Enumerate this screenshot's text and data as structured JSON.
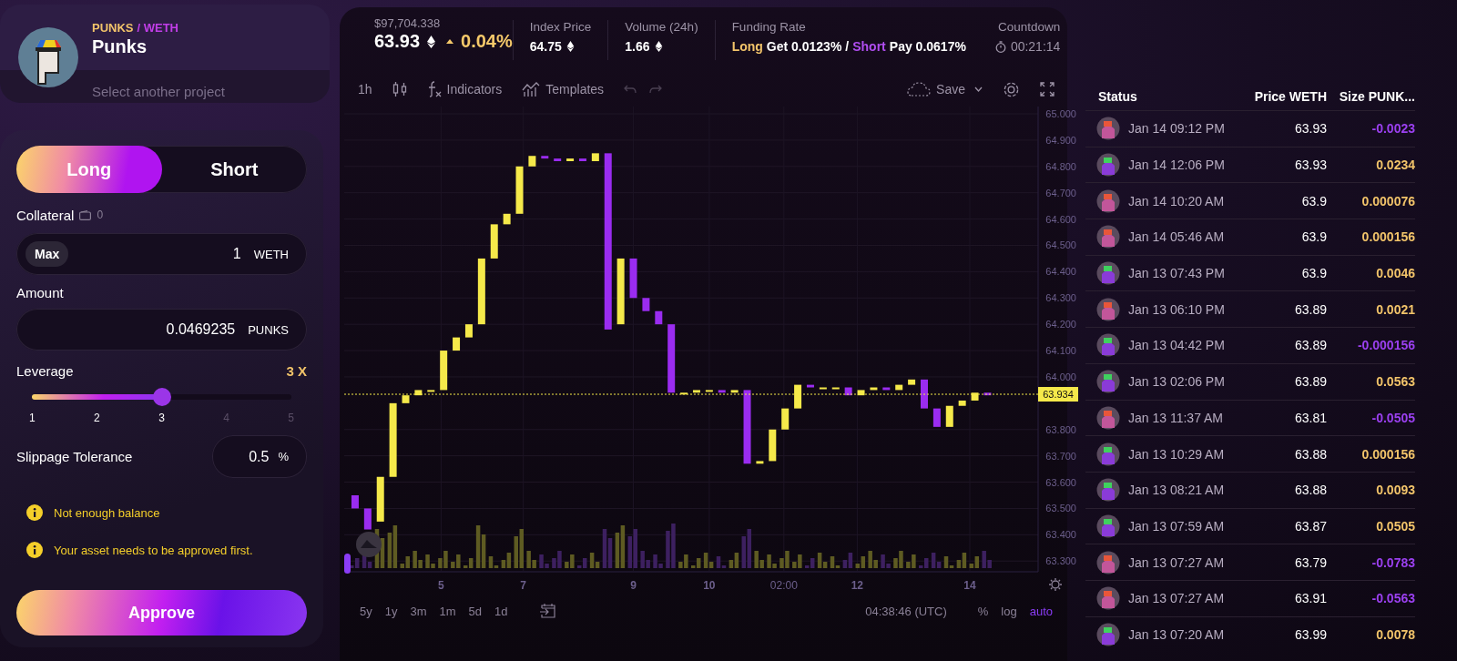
{
  "project": {
    "base": "PUNKS",
    "quote": "/ WETH",
    "name": "Punks",
    "action": "Select another project"
  },
  "order": {
    "sides": [
      {
        "label": "Long",
        "selected": true
      },
      {
        "label": "Short",
        "selected": false
      }
    ],
    "collateral": {
      "label": "Collateral",
      "balance": "0",
      "max": "Max",
      "value": "1",
      "unit": "WETH"
    },
    "amount": {
      "label": "Amount",
      "value": "0.0469235",
      "unit": "PUNKS"
    },
    "leverage": {
      "label": "Leverage",
      "reading": "3 X",
      "level": 0.5,
      "ticks": [
        "1",
        "2",
        "3",
        "4",
        "5"
      ]
    },
    "slippage": {
      "label": "Slippage Tolerance",
      "value": "0.5",
      "unit": "%"
    },
    "warnings": [
      "Not enough balance",
      "Your asset needs to be approved first."
    ],
    "submit": "Approve"
  },
  "market": {
    "usd": "$97,704.338",
    "price": "63.93",
    "change": "0.04%",
    "change_up": true,
    "stats": [
      {
        "label": "Index Price",
        "value": "64.75"
      },
      {
        "label": "Volume (24h)",
        "value": "1.66"
      }
    ],
    "funding": {
      "label": "Funding Rate",
      "long": "Long",
      "long_text": "Get 0.0123%",
      "sep": "/",
      "short": "Short",
      "short_text": "Pay 0.0617%"
    },
    "countdown": {
      "label": "Countdown",
      "value": "00:21:14"
    }
  },
  "toolbar": {
    "interval": "1h",
    "indicators": "Indicators",
    "templates": "Templates",
    "save": "Save"
  },
  "chart": {
    "price_axis": [
      "65.000",
      "64.900",
      "64.800",
      "64.700",
      "64.600",
      "64.500",
      "64.400",
      "64.300",
      "64.200",
      "64.100",
      "64.000",
      "63.800",
      "63.700",
      "63.600",
      "63.500",
      "63.400",
      "63.300"
    ],
    "time_axis": [
      "5",
      "7",
      "9",
      "10",
      "02:00",
      "12",
      "14"
    ],
    "last_price": "63.934"
  },
  "ranges": [
    "5y",
    "1y",
    "3m",
    "1m",
    "5d",
    "1d"
  ],
  "clock": "04:38:46 (UTC)",
  "scale_options": [
    {
      "label": "%",
      "selected": false
    },
    {
      "label": "log",
      "selected": false
    },
    {
      "label": "auto",
      "selected": true
    }
  ],
  "trades": {
    "columns": [
      "Status",
      "Price WETH",
      "Size PUNK..."
    ],
    "rows": [
      {
        "avatar": {
          "kind": "orange"
        },
        "time": "Jan 14 09:12 PM",
        "price": "63.93",
        "size": "-0.0023",
        "kind": "negative"
      },
      {
        "avatar": {
          "kind": "green"
        },
        "time": "Jan 14 12:06 PM",
        "price": "63.93",
        "size": "0.0234",
        "kind": "positive"
      },
      {
        "avatar": {
          "kind": "orange"
        },
        "time": "Jan 14 10:20 AM",
        "price": "63.9",
        "size": "0.000076",
        "kind": "positive"
      },
      {
        "avatar": {
          "kind": "orange"
        },
        "time": "Jan 14 05:46 AM",
        "price": "63.9",
        "size": "0.000156",
        "kind": "positive"
      },
      {
        "avatar": {
          "kind": "green"
        },
        "time": "Jan 13 07:43 PM",
        "price": "63.9",
        "size": "0.0046",
        "kind": "positive"
      },
      {
        "avatar": {
          "kind": "orange"
        },
        "time": "Jan 13 06:10 PM",
        "price": "63.89",
        "size": "0.0021",
        "kind": "positive"
      },
      {
        "avatar": {
          "kind": "green"
        },
        "time": "Jan 13 04:42 PM",
        "price": "63.89",
        "size": "-0.000156",
        "kind": "negative"
      },
      {
        "avatar": {
          "kind": "green"
        },
        "time": "Jan 13 02:06 PM",
        "price": "63.89",
        "size": "0.0563",
        "kind": "positive"
      },
      {
        "avatar": {
          "kind": "orange"
        },
        "time": "Jan 13 11:37 AM",
        "price": "63.81",
        "size": "-0.0505",
        "kind": "negative"
      },
      {
        "avatar": {
          "kind": "green"
        },
        "time": "Jan 13 10:29 AM",
        "price": "63.88",
        "size": "0.000156",
        "kind": "positive"
      },
      {
        "avatar": {
          "kind": "green"
        },
        "time": "Jan 13 08:21 AM",
        "price": "63.88",
        "size": "0.0093",
        "kind": "positive"
      },
      {
        "avatar": {
          "kind": "green"
        },
        "time": "Jan 13 07:59 AM",
        "price": "63.87",
        "size": "0.0505",
        "kind": "positive"
      },
      {
        "avatar": {
          "kind": "orange"
        },
        "time": "Jan 13 07:27 AM",
        "price": "63.79",
        "size": "-0.0783",
        "kind": "negative"
      },
      {
        "avatar": {
          "kind": "orange"
        },
        "time": "Jan 13 07:27 AM",
        "price": "63.91",
        "size": "-0.0563",
        "kind": "negative"
      },
      {
        "avatar": {
          "kind": "green"
        },
        "time": "Jan 13 07:20 AM",
        "price": "63.99",
        "size": "0.0078",
        "kind": "positive"
      }
    ]
  }
}
